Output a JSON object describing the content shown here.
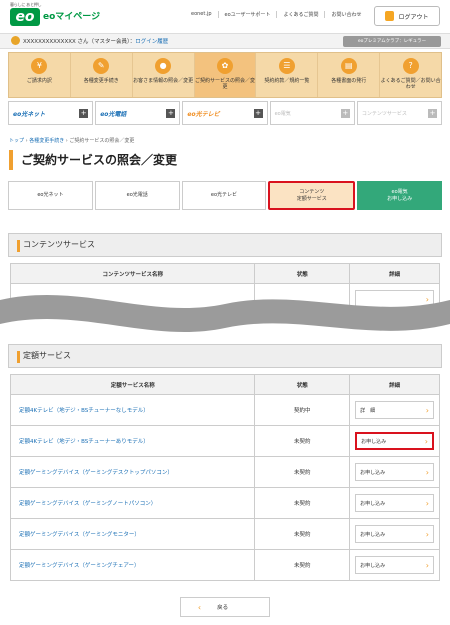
{
  "header": {
    "logo_tagline": "暮らしに あと押し",
    "logo_mark": "eo",
    "logo_name": "eoマイページ",
    "links": [
      "eonet.jp",
      "eoユーザーサポート",
      "よくあるご質問",
      "お問い合わせ"
    ],
    "logout_label": "ログアウト"
  },
  "userbar": {
    "user_name": "XXXXXXXXXXXXXX さん（マスター会員）",
    "login_history": "ログイン履歴",
    "club_label": "eoプレミアムクラブ：レギュラー"
  },
  "nav": {
    "items": [
      {
        "label": "ご請求内訳",
        "icon": "yen-icon",
        "glyph": "¥"
      },
      {
        "label": "各種変更手続き",
        "icon": "pencil-icon",
        "glyph": "✎"
      },
      {
        "label": "お客さま情報の照会／変更",
        "icon": "person-icon",
        "glyph": "●"
      },
      {
        "label": "ご契約サービスの照会／変更",
        "icon": "gear-icon",
        "glyph": "✿"
      },
      {
        "label": "契約約款／規約一覧",
        "icon": "document-icon",
        "glyph": "☰"
      },
      {
        "label": "各種書面の発行",
        "icon": "print-icon",
        "glyph": "▤"
      },
      {
        "label": "よくあるご質問／お問い合わせ",
        "icon": "question-icon",
        "glyph": "?"
      }
    ]
  },
  "services": [
    {
      "label": "eo光ネット",
      "color": "#1a6fb5",
      "disabled": false
    },
    {
      "label": "eo光電話",
      "color": "#1a6fb5",
      "disabled": false
    },
    {
      "label": "eo光テレビ",
      "color": "#f08c1e",
      "disabled": false
    },
    {
      "label": "eo電気",
      "color": "#bbb",
      "disabled": true
    },
    {
      "label": "コンテンツサービス",
      "color": "#bbb",
      "disabled": true
    }
  ],
  "breadcrumb": {
    "top": "トップ",
    "level1": "各種変更手続き",
    "current": "ご契約サービスの照会／変更"
  },
  "page_title": "ご契約サービスの照会／変更",
  "subtabs": [
    "eo光ネット",
    "eo光電話",
    "eo光テレビ",
    "コンテンツ\n定額サービス",
    "eo電気\nお申し込み"
  ],
  "content_section": {
    "heading": "コンテンツサービス",
    "headers": [
      "コンテンツサービス名称",
      "状態",
      "詳細"
    ]
  },
  "fixed_section": {
    "heading": "定額サービス",
    "headers": [
      "定額サービス名称",
      "状態",
      "詳細"
    ],
    "rows": [
      {
        "name": "定額4Kテレビ（地デジ・BSチューナーなしモデル）",
        "status": "契約中",
        "action": "詳　細"
      },
      {
        "name": "定額4Kテレビ（地デジ・BSチューナーありモデル）",
        "status": "未契約",
        "action": "お申し込み"
      },
      {
        "name": "定額ゲーミングデバイス（ゲーミングデスクトップパソコン）",
        "status": "未契約",
        "action": "お申し込み"
      },
      {
        "name": "定額ゲーミングデバイス（ゲーミングノートパソコン）",
        "status": "未契約",
        "action": "お申し込み"
      },
      {
        "name": "定額ゲーミングデバイス（ゲーミングモニター）",
        "status": "未契約",
        "action": "お申し込み"
      },
      {
        "name": "定額ゲーミングデバイス（ゲーミングチェアー）",
        "status": "未契約",
        "action": "お申し込み"
      }
    ]
  },
  "back_label": "戻る",
  "colors": {
    "accent": "#f0a030",
    "brand": "#009944",
    "highlight": "#d9121e",
    "link": "#1a6fb5"
  }
}
